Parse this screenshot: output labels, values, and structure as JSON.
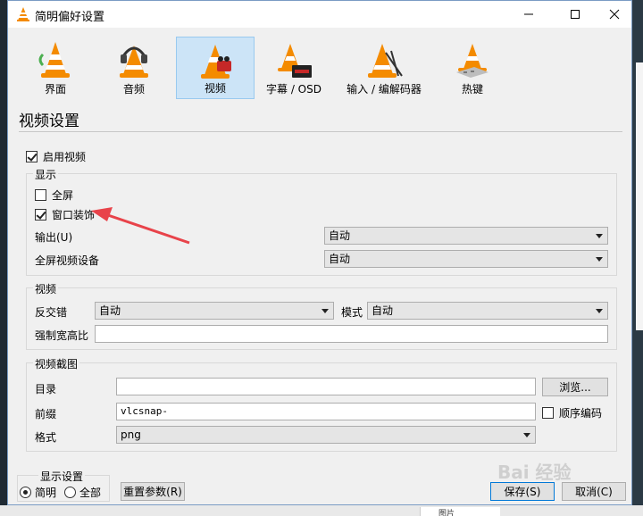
{
  "window": {
    "title": "简明偏好设置"
  },
  "toolbar": {
    "items": [
      {
        "label": "界面",
        "icon": "vlc-cone-icon"
      },
      {
        "label": "音频",
        "icon": "vlc-headphones-icon"
      },
      {
        "label": "视频",
        "icon": "vlc-video-icon"
      },
      {
        "label": "字幕 / OSD",
        "icon": "vlc-subtitle-icon"
      },
      {
        "label": "输入 / 编解码器",
        "icon": "vlc-codec-icon"
      },
      {
        "label": "热键",
        "icon": "vlc-hotkey-icon"
      }
    ],
    "selected": "视频"
  },
  "page": {
    "title": "视频设置"
  },
  "enable_video": {
    "label": "启用视频",
    "checked": true
  },
  "display": {
    "group_label": "显示",
    "fullscreen": {
      "label": "全屏",
      "checked": false
    },
    "window_decorations": {
      "label": "窗口装饰",
      "checked": true
    },
    "output_label": "输出(U)",
    "output_value": "自动",
    "fullscreen_device_label": "全屏视频设备",
    "fullscreen_device_value": "自动"
  },
  "video": {
    "group_label": "视频",
    "deinterlace_label": "反交错",
    "deinterlace_value": "自动",
    "mode_label": "模式",
    "mode_value": "自动",
    "aspect_label": "强制宽高比",
    "aspect_value": ""
  },
  "snapshot": {
    "group_label": "视频截图",
    "dir_label": "目录",
    "dir_value": "",
    "browse_label": "浏览...",
    "prefix_label": "前缀",
    "prefix_value": "vlcsnap-",
    "sequential_label": "顺序编码",
    "sequential_checked": false,
    "format_label": "格式",
    "format_value": "png"
  },
  "footer": {
    "show_settings_label": "显示设置",
    "simple_label": "简明",
    "all_label": "全部",
    "selected_mode": "简明",
    "reset_label": "重置参数(R)",
    "save_label": "保存(S)",
    "cancel_label": "取消(C)"
  },
  "watermark": "Bai 经验",
  "taskbar": {
    "item_label": "图片"
  },
  "colors": {
    "selected_tab": "#cce4f7",
    "accent": "#0078d7",
    "annotation_arrow": "#e8434a",
    "vlc_orange": "#f48b00"
  }
}
